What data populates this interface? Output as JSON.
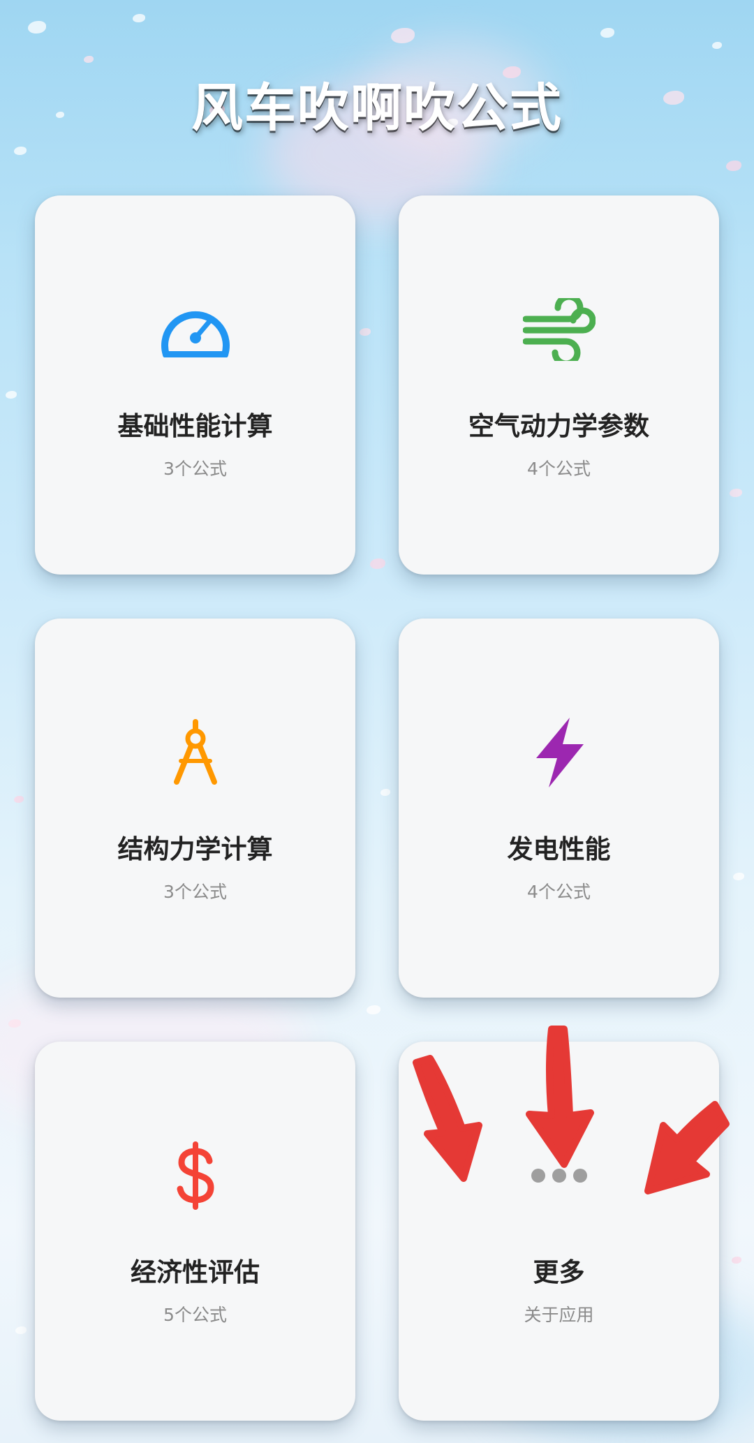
{
  "app": {
    "title": "风车吹啊吹公式"
  },
  "categories": [
    {
      "name": "基础性能计算",
      "subtitle": "3个公式",
      "icon": "speedometer-icon",
      "icon_color": "#2196F3"
    },
    {
      "name": "空气动力学参数",
      "subtitle": "4个公式",
      "icon": "wind-icon",
      "icon_color": "#4CAF50"
    },
    {
      "name": "结构力学计算",
      "subtitle": "3个公式",
      "icon": "compass-drafting-icon",
      "icon_color": "#FF9800"
    },
    {
      "name": "发电性能",
      "subtitle": "4个公式",
      "icon": "lightning-bolt-icon",
      "icon_color": "#9C27B0"
    },
    {
      "name": "经济性评估",
      "subtitle": "5个公式",
      "icon": "dollar-icon",
      "icon_color": "#F44336"
    },
    {
      "name": "更多",
      "subtitle": "关于应用",
      "icon": "more-dots-icon",
      "icon_color": "#9E9E9E"
    }
  ],
  "annotation": {
    "arrow_color": "#E53935",
    "arrow_count": 3,
    "arrow_target": "更多"
  }
}
